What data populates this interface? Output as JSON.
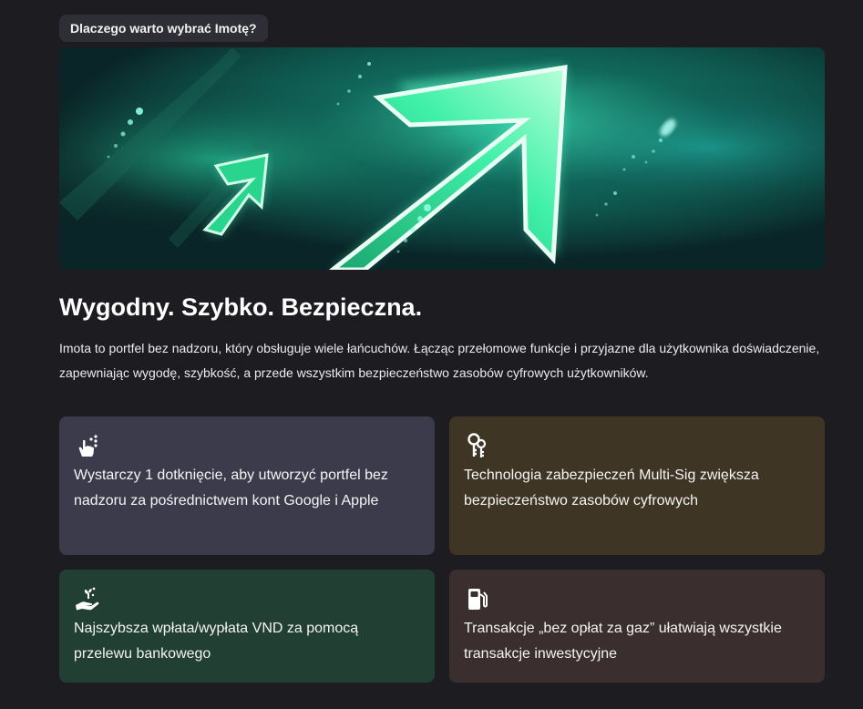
{
  "tag_label": "Dlaczego warto wybrać Imotę?",
  "banner": {
    "icon": "arrows-up-right-illustration"
  },
  "headline": "Wygodny. Szybko. Bezpieczna.",
  "description": "Imota to portfel bez nadzoru, który obsługuje wiele łańcuchów. Łącząc przełomowe funkcje i przyjazne dla użytkownika doświadczenie, zapewniając wygodę, szybkość, a przede wszystkim bezpieczeństwo zasobów cyfrowych użytkowników.",
  "features": [
    {
      "icon": "tap-icon",
      "text": "Wystarczy 1 dotknięcie, aby utworzyć portfel bez nadzoru za pośrednictwem kont Google i Apple",
      "bg": "#3c3b4c"
    },
    {
      "icon": "keys-icon",
      "text": "Technologia zabezpieczeń Multi-Sig zwiększa bezpieczeństwo zasobów cyfrowych",
      "bg": "#3f3524"
    },
    {
      "icon": "hand-coin-icon",
      "text": "Najszybsza wpłata/wypłata VND za pomocą przelewu bankowego",
      "bg": "#223f33"
    },
    {
      "icon": "fuel-pump-icon",
      "text": "Transakcje „bez opłat za gaz” ułatwiają wszystkie transakcje inwestycyjne",
      "bg": "#3b2e2e"
    }
  ]
}
